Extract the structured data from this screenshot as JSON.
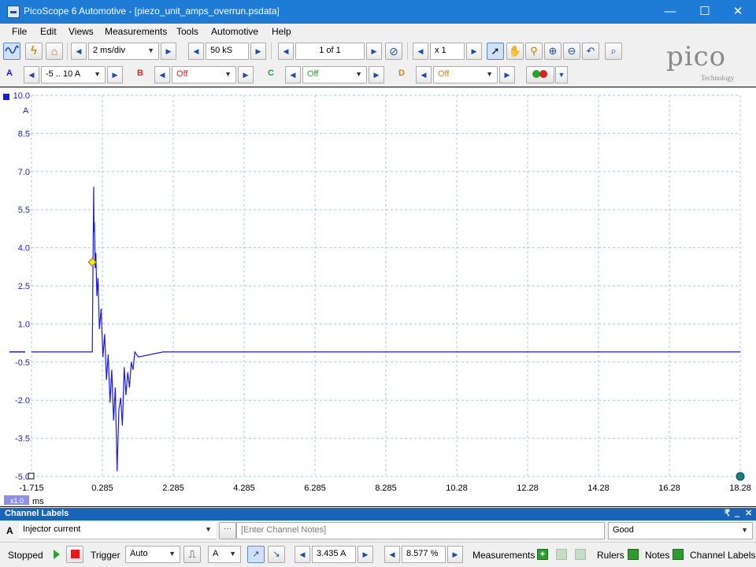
{
  "window": {
    "title": "PicoScope 6 Automotive - [piezo_unit_amps_overrun.psdata]",
    "minimize": "—",
    "maximize": "☐",
    "close": "✕"
  },
  "menu": [
    "File",
    "Edit",
    "Views",
    "Measurements",
    "Tools",
    "Automotive",
    "Help"
  ],
  "toolbar1": {
    "timebase": "2 ms/div",
    "samples": "50 kS",
    "buffer": "1 of 1",
    "zoom": "x 1"
  },
  "toolbar2": {
    "channel_a_letter": "A",
    "channel_a_range": "-5 .. 10 A",
    "channel_b_letter": "B",
    "channel_b_range": "Off",
    "channel_c_letter": "C",
    "channel_c_range": "Off",
    "channel_d_letter": "D",
    "channel_d_range": "Off"
  },
  "logo": {
    "word": "pico",
    "sub": "Technology"
  },
  "colors": {
    "trace": "#1a1adc",
    "grid": "#a9c9e3",
    "accent": "#1e7bd6",
    "channel_b": "#e0262a",
    "channel_c": "#2f9e2f",
    "channel_d": "#c98a0c"
  },
  "plot": {
    "y_unit": "A",
    "x_unit": "ms",
    "zoom_badge": "x1.0"
  },
  "chart_data": {
    "type": "line",
    "ylim": [
      -5.0,
      10.0
    ],
    "xlim": [
      -1.715,
      18.285
    ],
    "y_ticks": [
      "10.0",
      "8.5",
      "7.0",
      "5.5",
      "4.0",
      "2.5",
      "1.0",
      "-0.5",
      "-2.0",
      "-3.5",
      "-5.0"
    ],
    "x_ticks": [
      "-1.715",
      "0.285",
      "2.285",
      "4.285",
      "6.285",
      "8.285",
      "10.28",
      "12.28",
      "14.28",
      "16.28",
      "18.28"
    ],
    "series": [
      {
        "x": [
          -1.715,
          0.0,
          0.02,
          0.04,
          0.05,
          0.06,
          0.08,
          0.1,
          0.13,
          0.16,
          0.2,
          0.25,
          0.3,
          0.35,
          0.4,
          0.45,
          0.5,
          0.55,
          0.6,
          0.65,
          0.7,
          0.75,
          0.8,
          0.85,
          0.9,
          0.95,
          1.0,
          1.05,
          1.1,
          1.15,
          1.2,
          1.3,
          2.0,
          4.0,
          6.0,
          8.0,
          10.0,
          12.0,
          14.0,
          16.0,
          18.285
        ],
        "y": [
          -0.1,
          -0.1,
          3.5,
          6.4,
          4.6,
          5.0,
          3.2,
          3.8,
          2.1,
          2.8,
          0.8,
          1.6,
          -0.3,
          0.6,
          -1.2,
          -0.2,
          -2.1,
          -0.8,
          -2.8,
          -1.5,
          -4.8,
          -2.4,
          -1.9,
          -3.0,
          -0.7,
          -1.8,
          -0.9,
          -1.5,
          -0.5,
          -0.8,
          -0.1,
          -0.3,
          -0.1,
          -0.1,
          -0.1,
          -0.1,
          -0.1,
          -0.1,
          -0.1,
          -0.1,
          -0.1
        ]
      }
    ],
    "trigger_marker": {
      "x": 0.0,
      "y": 3.435
    }
  },
  "channel_labels": {
    "header": "Channel Labels",
    "channel": "A",
    "label": "Injector current",
    "notes_placeholder": "[Enter Channel Notes]",
    "quality": "Good",
    "pin": "₹",
    "minimize": "‗",
    "close": "✕"
  },
  "status": {
    "state": "Stopped",
    "trigger_label": "Trigger",
    "trigger_mode": "Auto",
    "trigger_channel": "A",
    "trigger_level": "3.435 A",
    "pretrigger": "8.577 %",
    "measurements": "Measurements",
    "rulers": "Rulers",
    "notes": "Notes",
    "channel_labels": "Channel Labels"
  }
}
